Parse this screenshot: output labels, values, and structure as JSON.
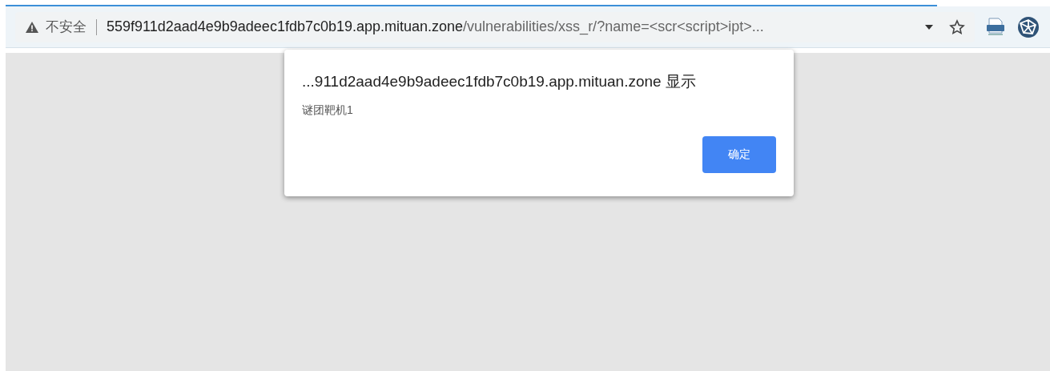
{
  "address_bar": {
    "security_label": "不安全",
    "url_host": "559f911d2aad4e9b9adeec1fdb7c0b19.app.mituan.zone",
    "url_path": "/vulnerabilities/xss_r/?name=<scr<script>ipt>..."
  },
  "dialog": {
    "title": "...911d2aad4e9b9adeec1fdb7c0b19.app.mituan.zone 显示",
    "message": "谜团靶机1",
    "buttons": [
      "确定"
    ]
  }
}
